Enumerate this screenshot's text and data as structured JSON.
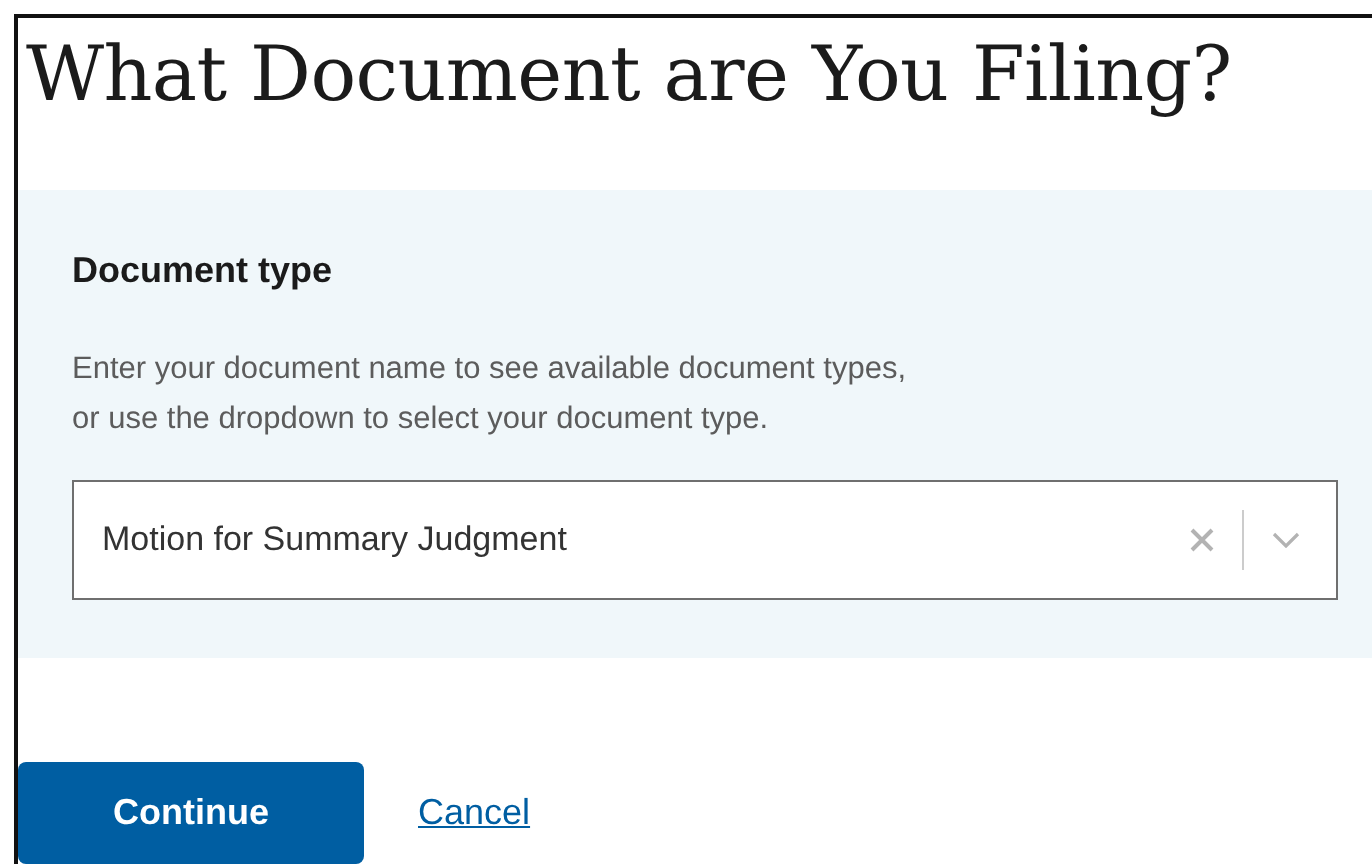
{
  "heading": "What Document are You Filing?",
  "document_type": {
    "label": "Document type",
    "hint_lines": [
      "Enter your document name to see available document types,",
      "or use the dropdown to select your document type."
    ],
    "value": "Motion for Summary Judgment"
  },
  "actions": {
    "primary": "Continue",
    "link": "Cancel"
  }
}
